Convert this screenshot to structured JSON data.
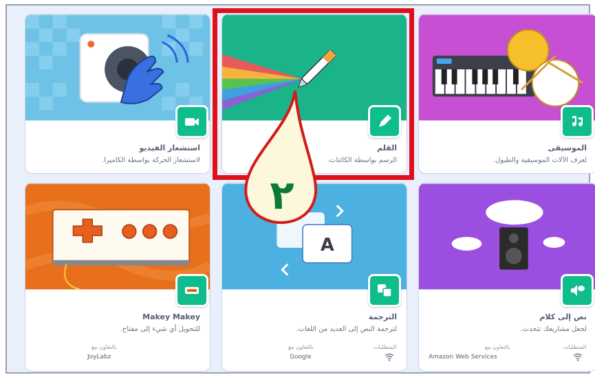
{
  "extensions": [
    {
      "title": "استشعار الفيديو",
      "desc": "لاستشعار الحركة بواسطة الكاميرا.",
      "icon": "video-sensing-icon",
      "theme": "#4bb2e0",
      "badge_color": "#0fbd8c"
    },
    {
      "title": "القلم",
      "desc": "الرسم بواسطة الكائنات.",
      "icon": "pen-icon",
      "theme": "#1ab38a",
      "badge_color": "#0fbd8c"
    },
    {
      "title": "الموسيقى",
      "desc": "لعزف الآلات الموسيقية والطبول.",
      "icon": "music-icon",
      "theme": "#c74fd4",
      "badge_color": "#0fbd8c"
    },
    {
      "title": "Makey Makey",
      "desc": "للتحويل أي شيء إلى مفتاح.",
      "icon": "makey-makey-icon",
      "theme": "#e8701c",
      "badge_color": "#0fbd8c",
      "collab_label": "بالتعاون مع",
      "collab_value": "JoyLabz"
    },
    {
      "title": "الترجمة",
      "desc": "لترجمة النص إلى العديد من اللغات.",
      "icon": "translate-icon",
      "theme": "#4cb1e0",
      "badge_color": "#0fbd8c",
      "collab_label": "بالتعاون مع",
      "collab_value": "Google",
      "requires_label": "المتطلبات",
      "requires_icon": "wifi-icon"
    },
    {
      "title": "نص إلى كلام",
      "desc": "لجعل مشاريعك تتحدث.",
      "icon": "text-to-speech-icon",
      "theme": "#9b4fe0",
      "badge_color": "#0fbd8c",
      "collab_label": "بالتعاون مع",
      "collab_value": "Amazon Web Services",
      "requires_label": "المتطلبات",
      "requires_icon": "wifi-icon"
    }
  ],
  "annotation": {
    "number": "٢",
    "highlight_color": "#e0101a",
    "callout_fill": "#fdf8dc",
    "callout_stroke": "#d31a1a",
    "number_color": "#0a7a36"
  }
}
